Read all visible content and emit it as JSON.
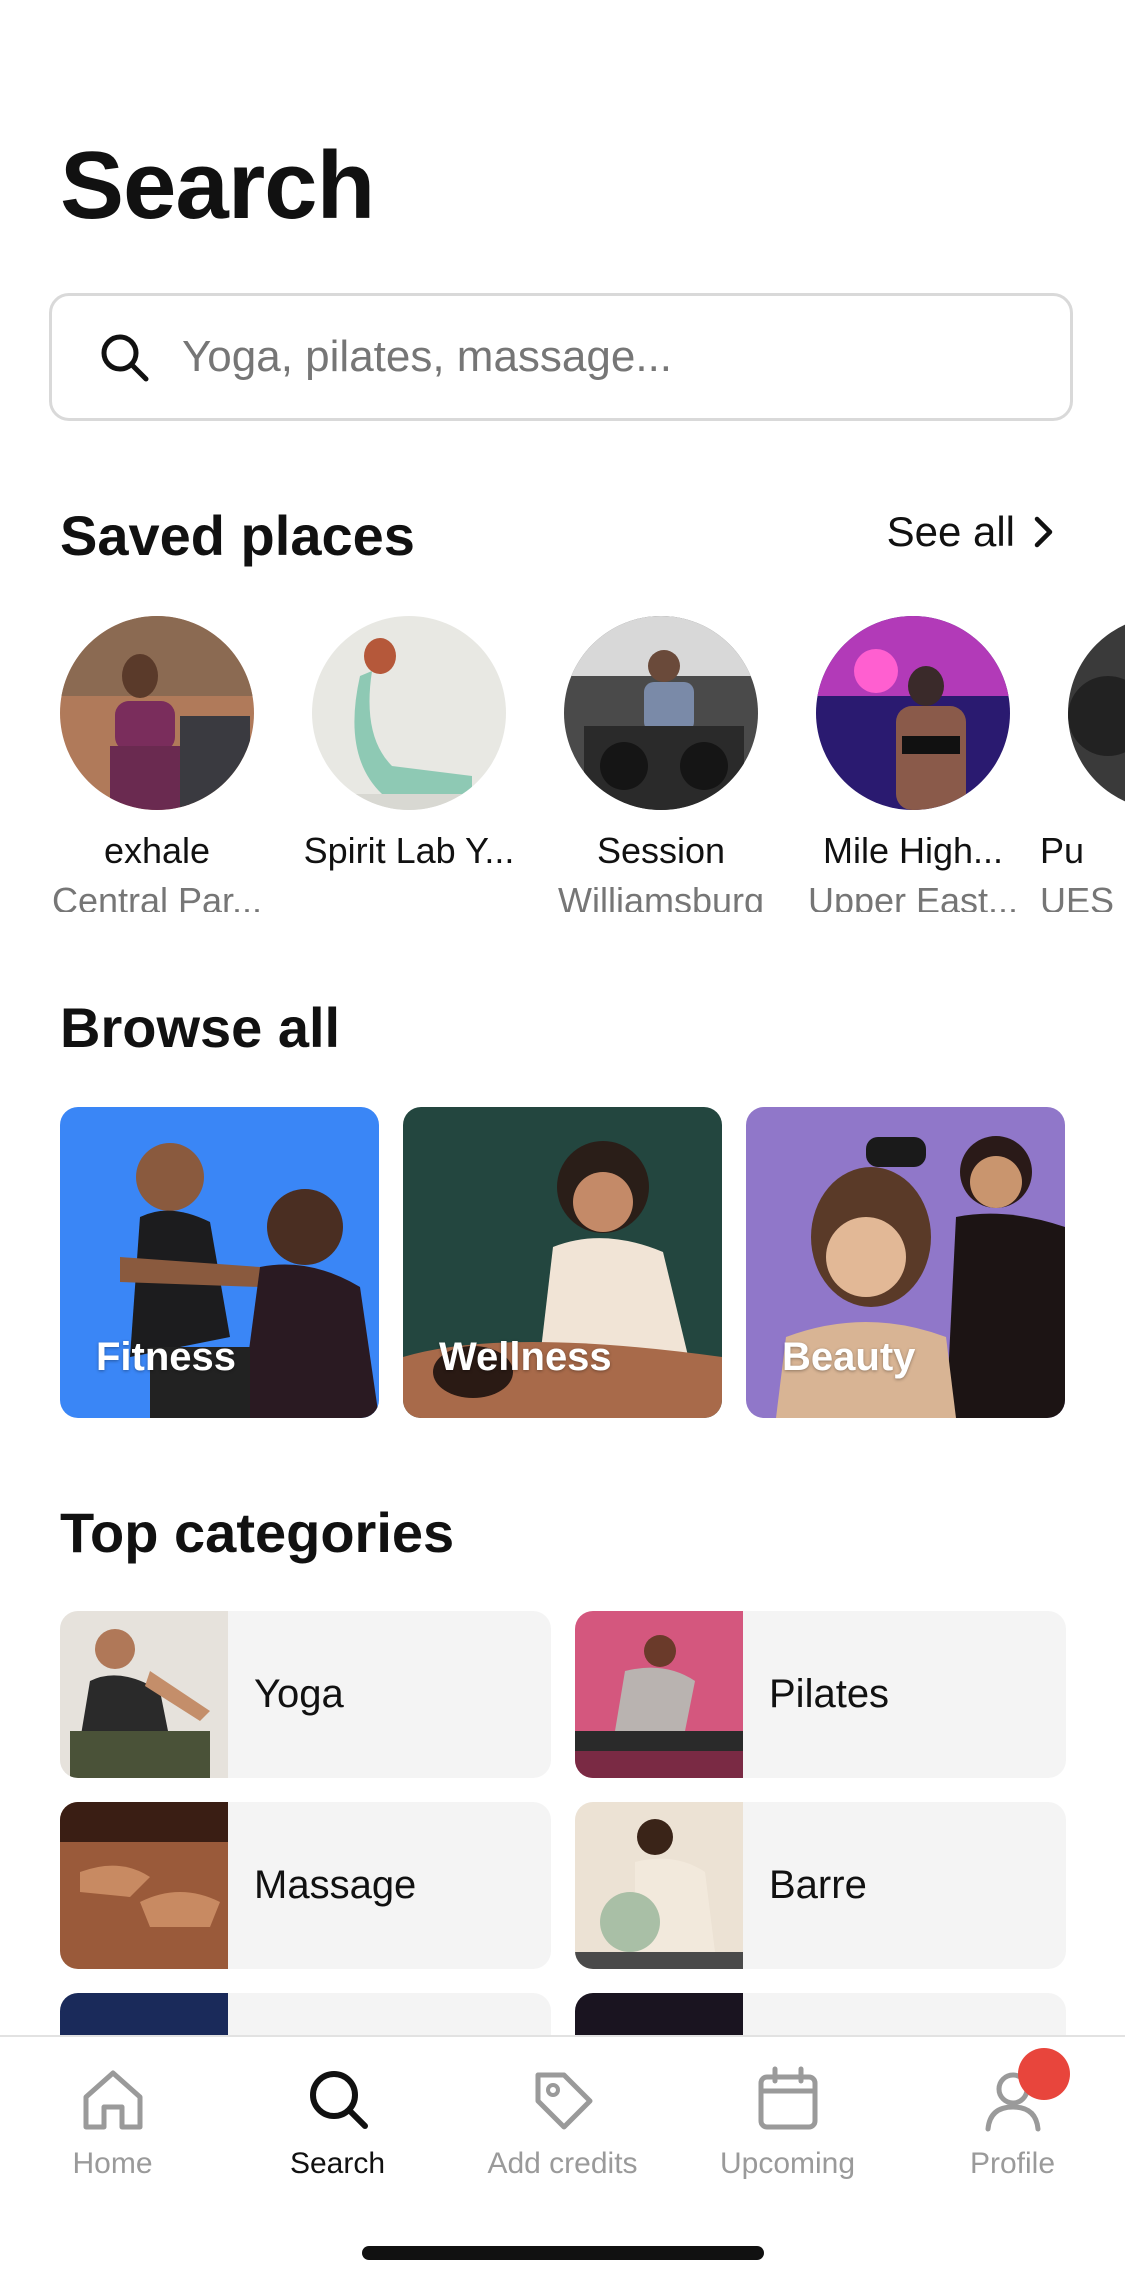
{
  "header": {
    "title": "Search"
  },
  "search": {
    "placeholder": "Yoga, pilates, massage..."
  },
  "saved_places": {
    "title": "Saved places",
    "see_all": "See all",
    "items": [
      {
        "name": "exhale",
        "location": "Central Par..."
      },
      {
        "name": "Spirit Lab Y...",
        "location": ""
      },
      {
        "name": "Session",
        "location": "Williamsburg"
      },
      {
        "name": "Mile High...",
        "location": "Upper East..."
      },
      {
        "name": "Pu",
        "location": "UES"
      }
    ]
  },
  "browse_all": {
    "title": "Browse all",
    "cards": [
      {
        "label": "Fitness",
        "color": "#3a86f6"
      },
      {
        "label": "Wellness",
        "color": "#23463f"
      },
      {
        "label": "Beauty",
        "color": "#9077c9"
      }
    ]
  },
  "top_categories": {
    "title": "Top categories",
    "items": [
      {
        "label": "Yoga"
      },
      {
        "label": "Pilates"
      },
      {
        "label": "Massage"
      },
      {
        "label": "Barre"
      }
    ]
  },
  "tabbar": {
    "items": [
      {
        "label": "Home",
        "icon": "home-icon",
        "active": false
      },
      {
        "label": "Search",
        "icon": "search-icon",
        "active": true
      },
      {
        "label": "Add credits",
        "icon": "tag-icon",
        "active": false
      },
      {
        "label": "Upcoming",
        "icon": "calendar-icon",
        "active": false
      },
      {
        "label": "Profile",
        "icon": "person-icon",
        "active": false
      }
    ]
  },
  "colors": {
    "badge": "#e8453c",
    "text": "#111111",
    "muted": "#767676"
  }
}
